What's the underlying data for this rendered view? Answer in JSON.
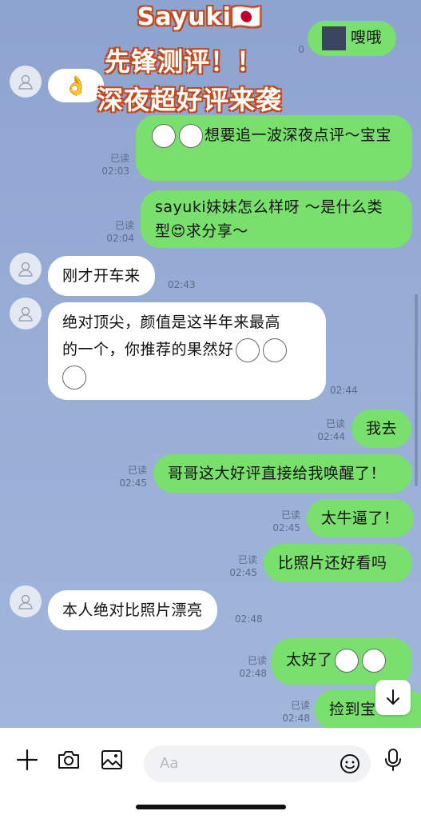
{
  "overlay": {
    "line1": "Sayuki🇯🇵",
    "line2": "先锋测评！！",
    "line3": "深夜超好评来袭"
  },
  "messages": [
    {
      "id": "m0",
      "side": "out",
      "text": "嗖哦",
      "read": "",
      "time": "0"
    },
    {
      "id": "m1",
      "side": "in",
      "text": "👌"
    },
    {
      "id": "m2",
      "side": "out",
      "text": "想要追一波深夜点评～宝宝",
      "read": "已读",
      "time": "02:03"
    },
    {
      "id": "m3",
      "side": "out",
      "text1": "sayuki妹妹怎么样呀 ～是什么类",
      "text2": "型",
      "text3": "求分享～",
      "read": "已读",
      "time": "02:04"
    },
    {
      "id": "m4",
      "side": "in",
      "text": "刚才开车来",
      "time": "02:43"
    },
    {
      "id": "m5",
      "side": "in",
      "text1": "绝对顶尖，颜值是这半年来最高",
      "text2": "的一个，你推荐的果然好",
      "time": "02:44"
    },
    {
      "id": "m6",
      "side": "out",
      "text": "我去",
      "read": "已读",
      "time": "02:44"
    },
    {
      "id": "m7",
      "side": "out",
      "text": "哥哥这大好评直接给我唤醒了！",
      "read": "已读",
      "time": "02:45"
    },
    {
      "id": "m8",
      "side": "out",
      "text": "太牛逼了！",
      "read": "已读",
      "time": "02:45"
    },
    {
      "id": "m9",
      "side": "out",
      "text": "比照片还好看吗",
      "read": "已读",
      "time": "02:45"
    },
    {
      "id": "m10",
      "side": "in",
      "text": "本人绝对比照片漂亮",
      "time": "02:48"
    },
    {
      "id": "m11",
      "side": "out",
      "text": "太好了",
      "read": "已读",
      "time": "02:48"
    },
    {
      "id": "m12",
      "side": "out",
      "text": "捡到宝",
      "read": "已读",
      "time": "02:48"
    }
  ],
  "input": {
    "placeholder": "Aa"
  },
  "icons": [
    "plus-icon",
    "camera-icon",
    "image-icon",
    "emoji-icon",
    "microphone-icon",
    "arrow-down-icon",
    "avatar-person-icon"
  ]
}
